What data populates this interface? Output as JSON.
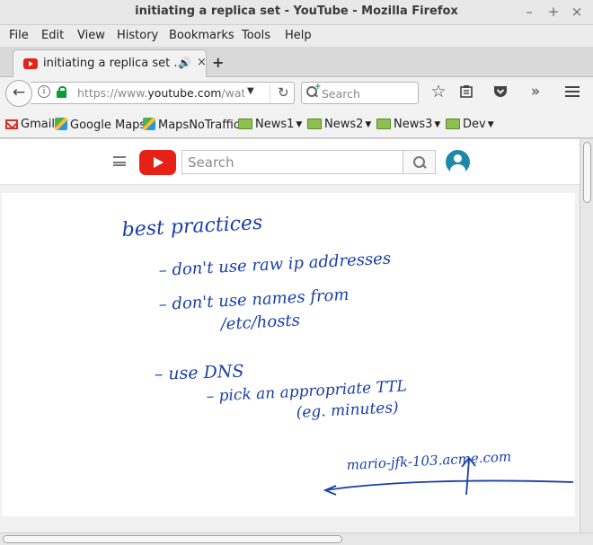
{
  "window": {
    "title": "initiating a replica set - YouTube - Mozilla Firefox",
    "controls": {
      "minimize": "–",
      "maximize": "+",
      "close": "×"
    }
  },
  "menu": [
    "File",
    "Edit",
    "View",
    "History",
    "Bookmarks",
    "Tools",
    "Help"
  ],
  "tab": {
    "title": "initiating a replica set ...",
    "favicon": "youtube-icon",
    "audio_icon": "speaker-icon",
    "close": "×",
    "new_tab": "+"
  },
  "navbar": {
    "url_prefix": "https://www.",
    "url_domain": "youtube.com",
    "url_suffix": "/watch?",
    "search_placeholder": "Search",
    "icons": [
      "back-icon",
      "info-icon",
      "lock-icon",
      "dropdown-icon",
      "reload-icon",
      "star-icon",
      "reading-list-icon",
      "pocket-icon",
      "overflow-icon",
      "menu-icon"
    ]
  },
  "bookmarks": [
    {
      "label": "Gmail",
      "icon": "gmail-icon"
    },
    {
      "label": "Google Maps",
      "icon": "maps-icon"
    },
    {
      "label": "MapsNoTraffic",
      "icon": "maps-icon"
    },
    {
      "label": "News1",
      "icon": "folder-icon",
      "menu": true
    },
    {
      "label": "News2",
      "icon": "folder-icon",
      "menu": true
    },
    {
      "label": "News3",
      "icon": "folder-icon",
      "menu": true
    },
    {
      "label": "Dev",
      "icon": "folder-icon",
      "menu": true
    }
  ],
  "youtube": {
    "search_placeholder": "Search"
  },
  "whiteboard": {
    "ink_color": "#1a3fa8",
    "lines": [
      "best practices",
      "– don't use raw ip addresses",
      "– don't use names from",
      "/etc/hosts",
      "– use DNS",
      "– pick an appropriate TTL",
      "(eg. minutes)",
      "mario-jfk-103.acme.com"
    ]
  }
}
